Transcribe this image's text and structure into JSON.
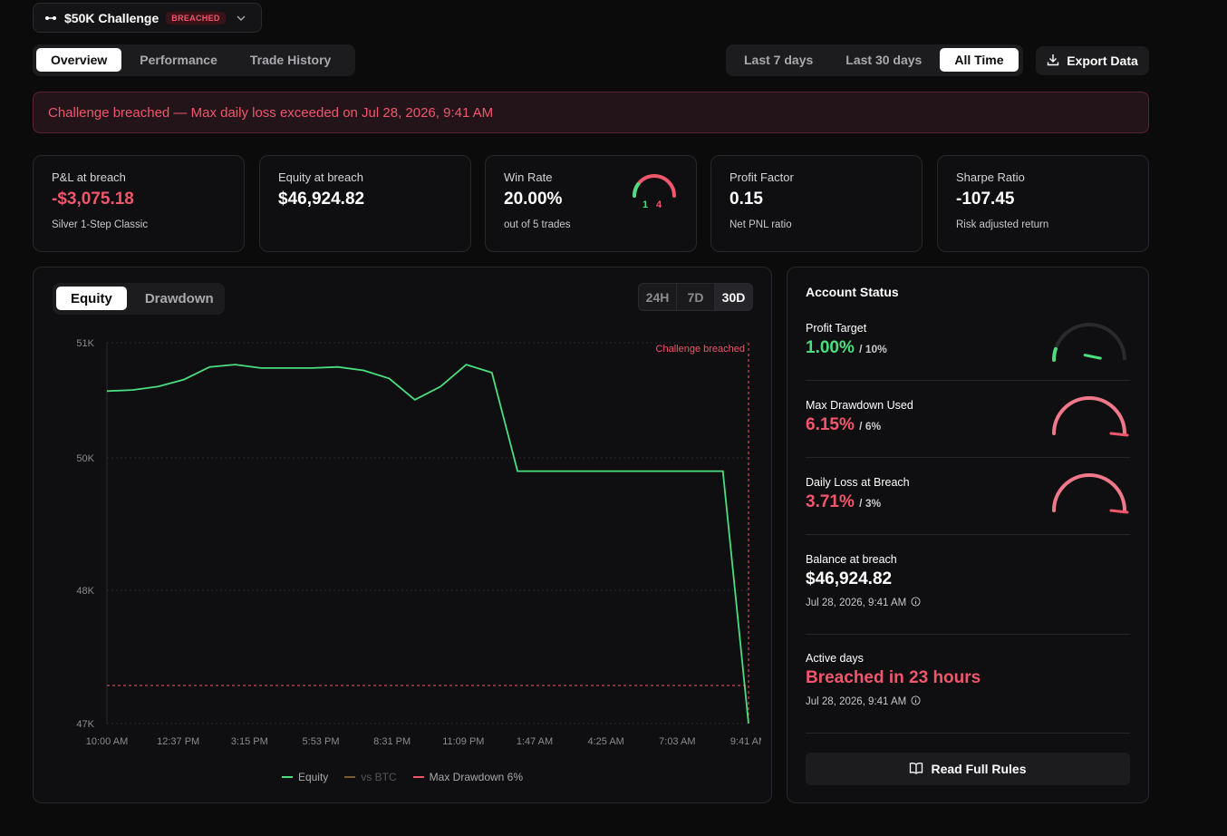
{
  "header": {
    "challenge_name": "$50K Challenge",
    "badge": "BREACHED",
    "logo_icon": "strategy-icon",
    "chevron_icon": "chevron-down-icon"
  },
  "main_tabs": [
    {
      "label": "Overview",
      "active": true
    },
    {
      "label": "Performance",
      "active": false
    },
    {
      "label": "Trade History",
      "active": false
    }
  ],
  "range_tabs": [
    {
      "label": "Last 7 days",
      "active": false
    },
    {
      "label": "Last 30 days",
      "active": false
    },
    {
      "label": "All Time",
      "active": true
    }
  ],
  "export": {
    "label": "Export Data",
    "icon": "download-icon"
  },
  "alert": {
    "text": "Challenge breached — Max daily loss exceeded on Jul 28, 2026, 9:41 AM"
  },
  "stats": {
    "pnl": {
      "label": "P&L at breach",
      "value": "-$3,075.18",
      "sub": "Silver 1-Step Classic"
    },
    "equity": {
      "label": "Equity at breach",
      "value": "$46,924.82"
    },
    "winrate": {
      "label": "Win Rate",
      "value": "20.00%",
      "sub": "out of 5 trades",
      "wins": "1",
      "losses": "4",
      "win_fraction": 0.2
    },
    "profit_factor": {
      "label": "Profit Factor",
      "value": "0.15",
      "sub": "Net PNL ratio"
    },
    "sharpe": {
      "label": "Sharpe Ratio",
      "value": "-107.45",
      "sub": "Risk adjusted return"
    }
  },
  "chart_tabs": [
    {
      "label": "Equity",
      "active": true
    },
    {
      "label": "Drawdown",
      "active": false
    }
  ],
  "timeframe_tabs": [
    {
      "label": "24H",
      "active": false
    },
    {
      "label": "7D",
      "active": false
    },
    {
      "label": "30D",
      "active": true
    }
  ],
  "chart_data": {
    "type": "line",
    "x": [
      "10:00 AM",
      "12:37 PM",
      "3:15 PM",
      "5:53 PM",
      "8:31 PM",
      "11:09 PM",
      "1:47 AM",
      "4:25 AM",
      "7:03 AM",
      "9:41 AM"
    ],
    "y_ticks": [
      "51K",
      "50K",
      "48K",
      "47K"
    ],
    "y_tick_values": [
      51000,
      50000,
      48000,
      47000
    ],
    "series": [
      {
        "name": "Equity",
        "color": "#4ade80",
        "values": [
          50580,
          50590,
          50620,
          50680,
          50790,
          50810,
          50780,
          50780,
          50780,
          50790,
          50760,
          50690,
          50505,
          50620,
          50810,
          50740,
          49800,
          49800,
          49800,
          49800,
          49800,
          49800,
          49800,
          49800,
          49800,
          46920
        ]
      },
      {
        "name": "vs BTC",
        "color": "#7a5a2e",
        "values": []
      },
      {
        "name": "Max Drawdown 6%",
        "color": "#f0566c",
        "values": [
          47000
        ]
      }
    ],
    "annotation": "Challenge breached",
    "breach_label_color": "#f0566c"
  },
  "status": {
    "title": "Account Status",
    "profit_target": {
      "label": "Profit Target",
      "value": "1.00%",
      "of": "/ 10%",
      "fraction": 0.1
    },
    "max_drawdown": {
      "label": "Max Drawdown Used",
      "value": "6.15%",
      "of": "/ 6%",
      "fraction": 1.0
    },
    "daily_loss": {
      "label": "Daily Loss at Breach",
      "value": "3.71%",
      "of": "/ 3%",
      "fraction": 1.0
    },
    "balance": {
      "label": "Balance at breach",
      "value": "$46,924.82",
      "date": "Jul 28, 2026, 9:41 AM"
    },
    "active_days": {
      "label": "Active days",
      "value": "Breached in 23 hours",
      "date": "Jul 28, 2026, 9:41 AM"
    },
    "rules_button": "Read Full Rules",
    "rules_icon": "book-icon",
    "info_icon": "info-icon"
  }
}
